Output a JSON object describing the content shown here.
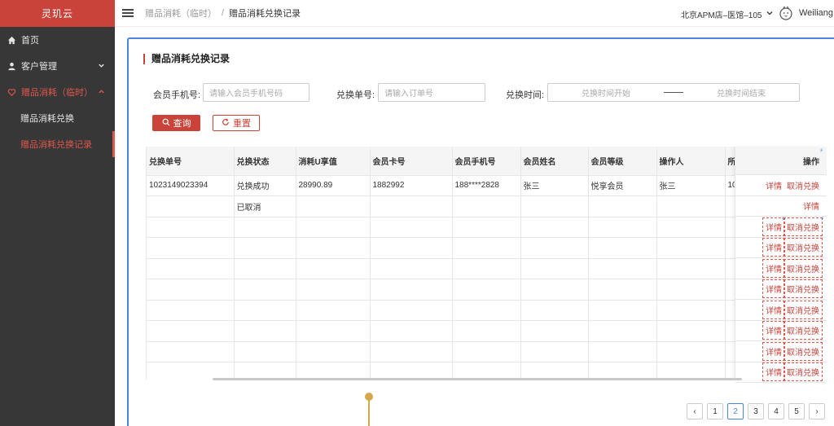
{
  "brand": "灵玑云",
  "sidebar": {
    "items": [
      {
        "label": "首页",
        "icon": "home-icon"
      },
      {
        "label": "客户管理",
        "icon": "user-icon"
      },
      {
        "label": "赠品消耗（临时）",
        "icon": "heart-icon"
      }
    ],
    "sub_items": [
      {
        "label": "赠品消耗兑换"
      },
      {
        "label": "赠品消耗兑换记录"
      }
    ]
  },
  "header": {
    "breadcrumb": [
      "赠品消耗（临时）",
      "赠品消耗兑换记录"
    ],
    "breadcrumb_sep": "/",
    "store": "北京APM店–医馆–105",
    "username": "Weiliang"
  },
  "page": {
    "title": "赠品消耗兑换记录"
  },
  "filters": {
    "phone_label": "会员手机号:",
    "phone_placeholder": "请输入会员手机号码",
    "order_label": "兑换单号:",
    "order_placeholder": "请输入订单号",
    "time_label": "兑换时间:",
    "time_start_placeholder": "兑换时间开始",
    "time_end_placeholder": "兑换时间结束"
  },
  "buttons": {
    "query": "查询",
    "reset": "重置"
  },
  "table": {
    "columns": [
      "兑换单号",
      "兑换状态",
      "消耗U享值",
      "会员卡号",
      "会员手机号",
      "会员姓名",
      "会员等级",
      "操作人",
      "所"
    ],
    "op_column": "操作",
    "rows": [
      [
        "1023149023394",
        "兑换成功",
        "28990.89",
        "1882992",
        "188****2828",
        "张三",
        "悦享会员",
        "张三",
        "10"
      ],
      [
        "",
        "已取消",
        "",
        "",
        "",
        "",
        "",
        "",
        ""
      ],
      [
        "",
        "",
        "",
        "",
        "",
        "",
        "",
        "",
        ""
      ],
      [
        "",
        "",
        "",
        "",
        "",
        "",
        "",
        "",
        ""
      ],
      [
        "",
        "",
        "",
        "",
        "",
        "",
        "",
        "",
        ""
      ],
      [
        "",
        "",
        "",
        "",
        "",
        "",
        "",
        "",
        ""
      ],
      [
        "",
        "",
        "",
        "",
        "",
        "",
        "",
        "",
        ""
      ],
      [
        "",
        "",
        "",
        "",
        "",
        "",
        "",
        "",
        ""
      ],
      [
        "",
        "",
        "",
        "",
        "",
        "",
        "",
        "",
        ""
      ],
      [
        "",
        "",
        "",
        "",
        "",
        "",
        "",
        "",
        ""
      ]
    ],
    "detail_label": "详情",
    "cancel_label": "取消兑换"
  },
  "pagination": {
    "pages": [
      "1",
      "2",
      "3",
      "4",
      "5"
    ],
    "current": "2",
    "prev": "‹",
    "next": "›"
  },
  "colors": {
    "accent": "#c9433a",
    "sidebar_bg": "#373737",
    "card_border": "#4a86e0"
  }
}
